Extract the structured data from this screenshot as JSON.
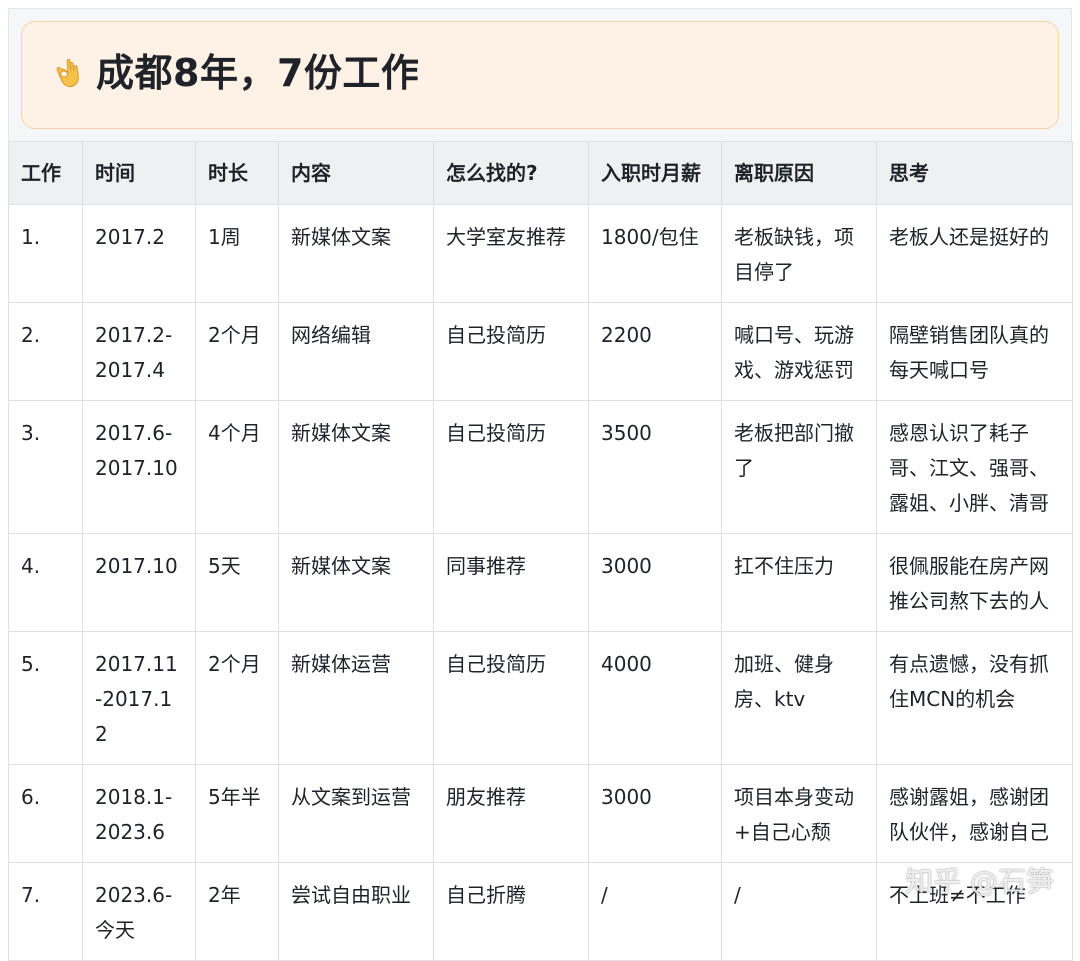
{
  "callout": {
    "emoji": "ok-hand-emoji",
    "title": "成都8年，7份工作"
  },
  "table": {
    "headers": [
      "工作",
      "时间",
      "时长",
      "内容",
      "怎么找的?",
      "入职时月薪",
      "离职原因",
      "思考"
    ],
    "rows": [
      [
        "1.",
        "2017.2",
        "1周",
        "新媒体文案",
        "大学室友推荐",
        "1800/包住",
        "老板缺钱，项目停了",
        "老板人还是挺好的"
      ],
      [
        "2.",
        "2017.2-2017.4",
        "2个月",
        "网络编辑",
        "自己投简历",
        "2200",
        "喊口号、玩游戏、游戏惩罚",
        "隔壁销售团队真的每天喊口号"
      ],
      [
        "3.",
        "2017.6-2017.10",
        "4个月",
        "新媒体文案",
        "自己投简历",
        "3500",
        "老板把部门撤了",
        "感恩认识了耗子哥、江文、强哥、露姐、小胖、清哥"
      ],
      [
        "4.",
        "2017.10",
        "5天",
        "新媒体文案",
        "同事推荐",
        "3000",
        "扛不住压力",
        "很佩服能在房产网推公司熬下去的人"
      ],
      [
        "5.",
        "2017.11-2017.12",
        "2个月",
        "新媒体运营",
        "自己投简历",
        "4000",
        "加班、健身房、ktv",
        "有点遗憾，没有抓住MCN的机会"
      ],
      [
        "6.",
        "2018.1-2023.6",
        "5年半",
        "从文案到运营",
        "朋友推荐",
        "3000",
        "项目本身变动+自己心颓",
        "感谢露姐，感谢团队伙伴，感谢自己"
      ],
      [
        "7.",
        "2023.6-今天",
        "2年",
        "尝试自由职业",
        "自己折腾",
        "/",
        "/",
        "不上班≠不工作"
      ]
    ]
  },
  "watermark": "知乎 @石笋",
  "colors": {
    "callout_bg": "#fef1e6",
    "callout_border": "#f7d2a4",
    "header_bg": "#eff0f1",
    "border": "#dee0e3"
  }
}
